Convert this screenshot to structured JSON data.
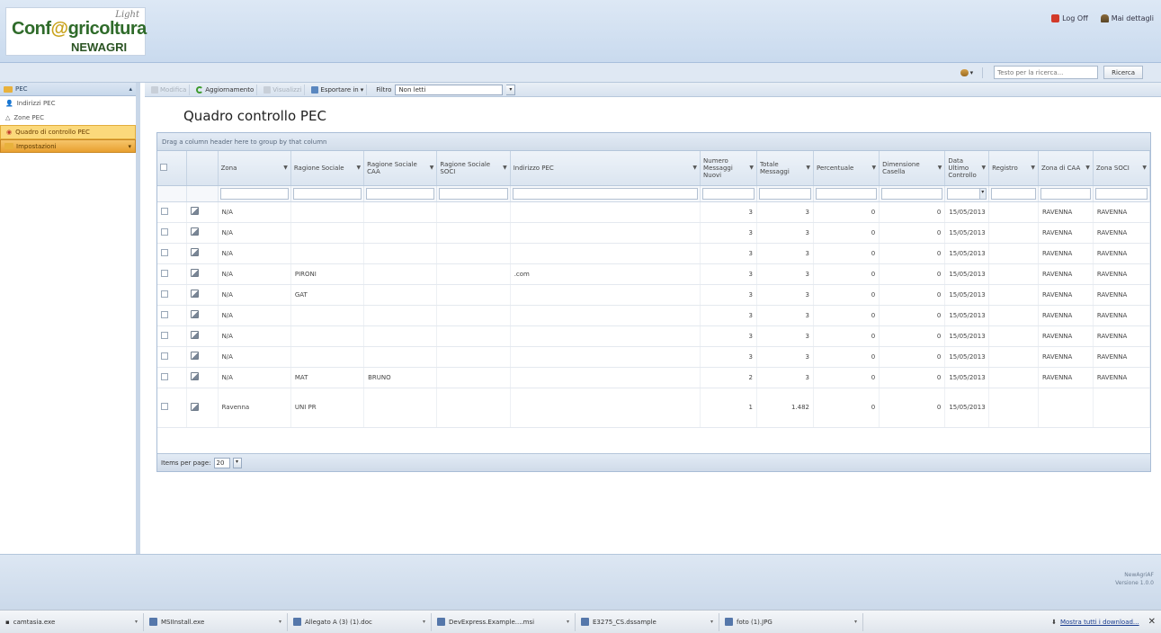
{
  "header": {
    "logo_light": "Light",
    "logo_brand_a": "Conf",
    "logo_brand_at": "@",
    "logo_brand_b": "gricoltura",
    "logo_sub": "NEWAGRI",
    "logoff_label": "Log Off",
    "details_label": "Mai dettagli"
  },
  "search": {
    "placeholder": "Testo per la ricerca...",
    "button_label": "Ricerca"
  },
  "nav": {
    "group_pec": "PEC",
    "items": [
      {
        "label": "Indirizzi PEC",
        "icon": "person-icon"
      },
      {
        "label": "Zone PEC",
        "icon": "triangle-icon"
      },
      {
        "label": "Quadro di controllo PEC",
        "icon": "control-icon"
      }
    ],
    "group_settings": "Impostazioni"
  },
  "toolbar": {
    "edit_label": "Modifica",
    "refresh_label": "Aggiornamento",
    "view_label": "Visualizzi",
    "export_label": "Esportare in",
    "filter_label": "Filtro",
    "filter_value": "Non letti"
  },
  "page": {
    "title": "Quadro controllo PEC"
  },
  "grid": {
    "group_hint": "Drag a column header here to group by that column",
    "columns": [
      "Zona",
      "Ragione Sociale",
      "Ragione Sociale CAA",
      "Ragione Sociale SOCI",
      "Indirizzo PEC",
      "Numero Messaggi Nuovi",
      "Totale Messaggi",
      "Percentuale",
      "Dimensione Casella",
      "Data Ultimo Controllo",
      "Registro",
      "Zona di CAA",
      "Zona SOCI"
    ],
    "rows": [
      {
        "zona": "N/A",
        "rs": "",
        "rs_caa": "",
        "rs_soci": "",
        "pec": "",
        "nuovi": "3",
        "totale": "3",
        "perc": "0",
        "dim": "0",
        "data": "15/05/2013",
        "reg": "",
        "zona_caa": "RAVENNA",
        "zona_soci": "RAVENNA"
      },
      {
        "zona": "N/A",
        "rs": "",
        "rs_caa": "",
        "rs_soci": "",
        "pec": "",
        "nuovi": "3",
        "totale": "3",
        "perc": "0",
        "dim": "0",
        "data": "15/05/2013",
        "reg": "",
        "zona_caa": "RAVENNA",
        "zona_soci": "RAVENNA"
      },
      {
        "zona": "N/A",
        "rs": "",
        "rs_caa": "",
        "rs_soci": "",
        "pec": "",
        "nuovi": "3",
        "totale": "3",
        "perc": "0",
        "dim": "0",
        "data": "15/05/2013",
        "reg": "",
        "zona_caa": "RAVENNA",
        "zona_soci": "RAVENNA"
      },
      {
        "zona": "N/A",
        "rs": "PIRONI",
        "rs_caa": "",
        "rs_soci": "",
        "pec": ".com",
        "nuovi": "3",
        "totale": "3",
        "perc": "0",
        "dim": "0",
        "data": "15/05/2013",
        "reg": "",
        "zona_caa": "RAVENNA",
        "zona_soci": "RAVENNA"
      },
      {
        "zona": "N/A",
        "rs": "GAT",
        "rs_caa": "",
        "rs_soci": "",
        "pec": "",
        "nuovi": "3",
        "totale": "3",
        "perc": "0",
        "dim": "0",
        "data": "15/05/2013",
        "reg": "",
        "zona_caa": "RAVENNA",
        "zona_soci": "RAVENNA"
      },
      {
        "zona": "N/A",
        "rs": "",
        "rs_caa": "",
        "rs_soci": "",
        "pec": "",
        "nuovi": "3",
        "totale": "3",
        "perc": "0",
        "dim": "0",
        "data": "15/05/2013",
        "reg": "",
        "zona_caa": "RAVENNA",
        "zona_soci": "RAVENNA"
      },
      {
        "zona": "N/A",
        "rs": "",
        "rs_caa": "",
        "rs_soci": "",
        "pec": "",
        "nuovi": "3",
        "totale": "3",
        "perc": "0",
        "dim": "0",
        "data": "15/05/2013",
        "reg": "",
        "zona_caa": "RAVENNA",
        "zona_soci": "RAVENNA"
      },
      {
        "zona": "N/A",
        "rs": "",
        "rs_caa": "",
        "rs_soci": "",
        "pec": "",
        "nuovi": "3",
        "totale": "3",
        "perc": "0",
        "dim": "0",
        "data": "15/05/2013",
        "reg": "",
        "zona_caa": "RAVENNA",
        "zona_soci": "RAVENNA"
      },
      {
        "zona": "N/A",
        "rs": "MAT",
        "rs_caa": "BRUNO",
        "rs_soci": "",
        "pec": "",
        "nuovi": "2",
        "totale": "3",
        "perc": "0",
        "dim": "0",
        "data": "15/05/2013",
        "reg": "",
        "zona_caa": "RAVENNA",
        "zona_soci": "RAVENNA"
      },
      {
        "zona": "Ravenna",
        "rs": "UNI PR",
        "rs_caa": "",
        "rs_soci": "",
        "pec": "",
        "nuovi": "1",
        "totale": "1.482",
        "perc": "0",
        "dim": "0",
        "data": "15/05/2013",
        "reg": "",
        "zona_caa": "",
        "zona_soci": ""
      }
    ],
    "pager_label": "Items per page:",
    "pager_value": "20"
  },
  "footer": {
    "version_name": "NewAgriAF",
    "version_number": "Versione 1.0.0"
  },
  "downloads": {
    "items": [
      "camtasia.exe",
      "MSIInstall.exe",
      "Allegato A (3) (1).doc",
      "DevExpress.Example....msi",
      "E3275_CS.dssample",
      "foto (1).JPG"
    ],
    "show_all": "Mostra tutti i download..."
  },
  "colors": {
    "accent_orange": "#e8a030",
    "header_blue": "#c9daee",
    "logo_green": "#2f6b2a"
  }
}
